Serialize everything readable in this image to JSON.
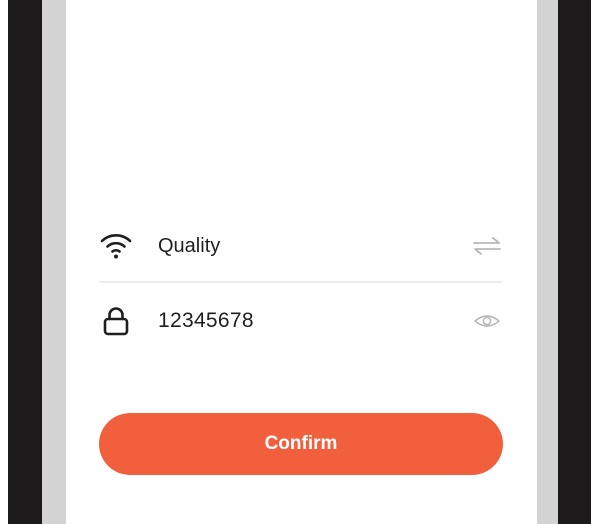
{
  "wifi_form": {
    "ssid": {
      "value": "Quality",
      "icon": "wifi-icon",
      "action_icon": "switch-network-icon"
    },
    "password": {
      "value": "12345678",
      "icon": "lock-icon",
      "action_icon": "eye-icon"
    },
    "confirm_label": "Confirm"
  },
  "colors": {
    "accent": "#f15f3c",
    "text": "#1f1f1f",
    "icon_muted": "#b9b9b9",
    "divider": "#ececec",
    "bezel": "#1c1a1b",
    "frame": "#d3d3d3"
  }
}
